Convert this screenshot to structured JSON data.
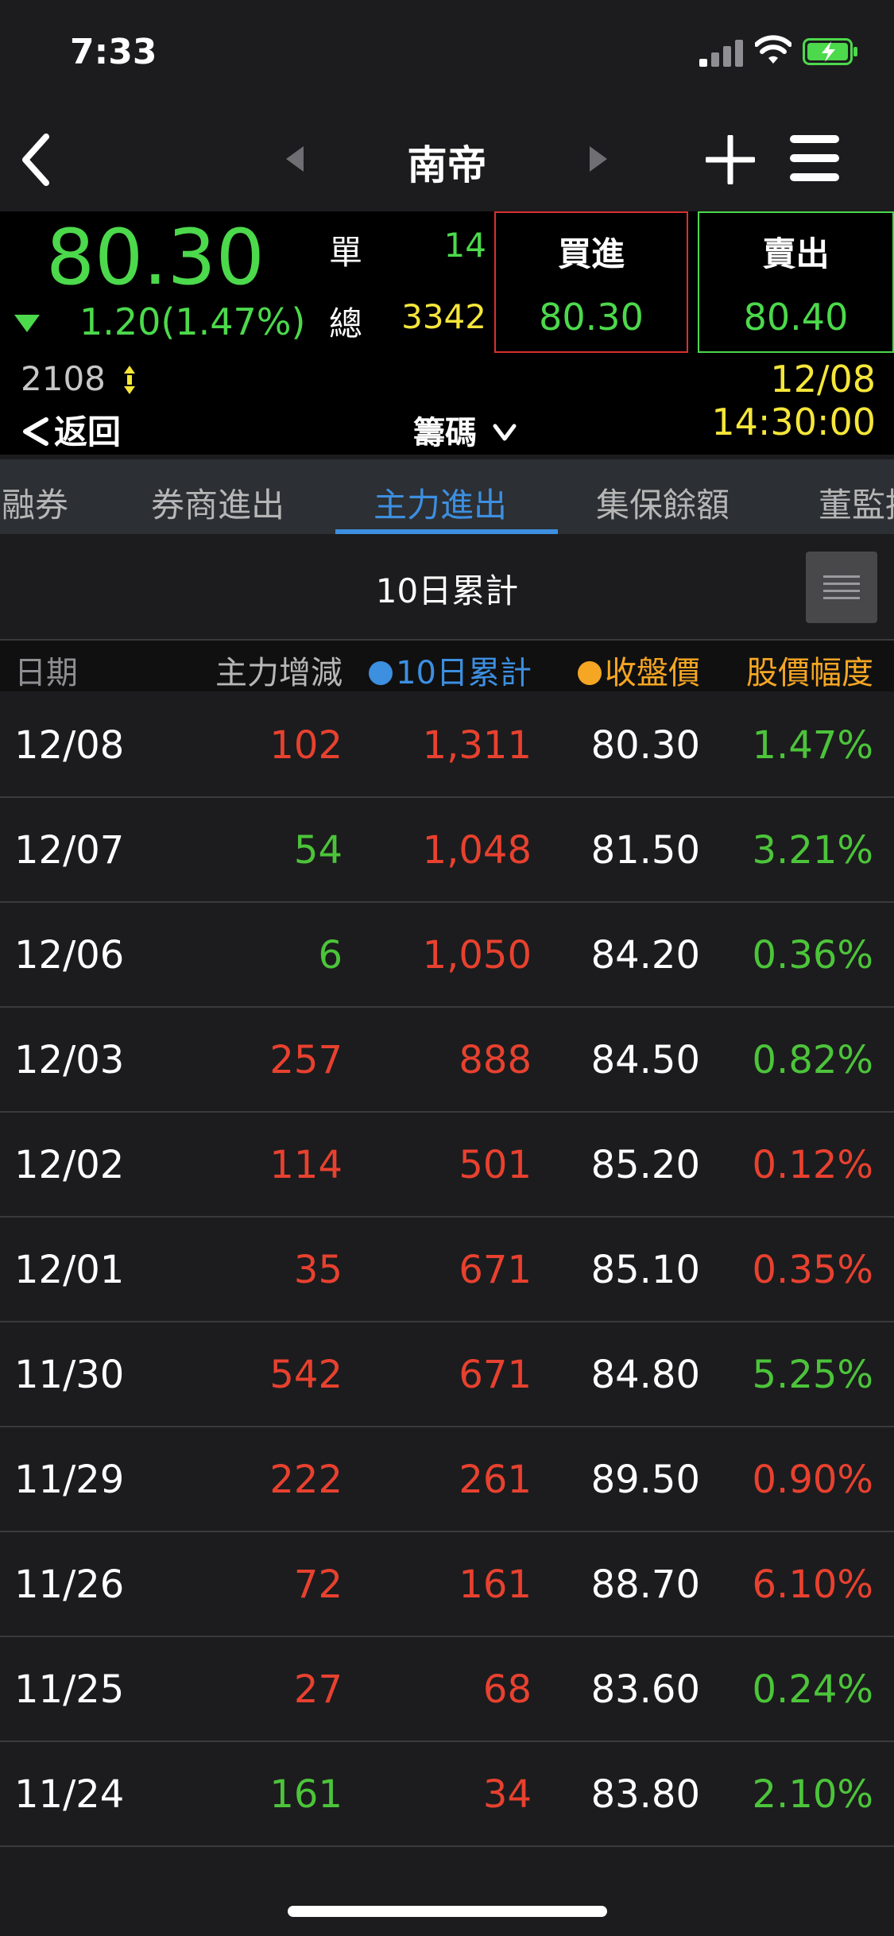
{
  "status_bar": {
    "time": "7:33"
  },
  "nav": {
    "title": "南帝"
  },
  "quote": {
    "price": "80.30",
    "change": "1.20(1.47%)",
    "unit_label": "單",
    "unit_value": "14",
    "total_label": "總",
    "total_value": "3342",
    "buy_label": "買進",
    "buy_price": "80.30",
    "sell_label": "賣出",
    "sell_price": "80.40",
    "volume": "2108",
    "datetime": "12/08 14:30:00",
    "back_label": "返回",
    "chips_label": "籌碼"
  },
  "tabs": [
    {
      "label": "融券"
    },
    {
      "label": "券商進出"
    },
    {
      "label": "主力進出"
    },
    {
      "label": "集保餘額"
    },
    {
      "label": "董監持股"
    }
  ],
  "section": {
    "title": "10日累計"
  },
  "columns": {
    "date": "日期",
    "main": "主力增減",
    "acc": "10日累計",
    "close": "收盤價",
    "pct": "股價幅度"
  },
  "colors": {
    "up": "#e8412f",
    "down": "#4cc43a",
    "accent": "#3d8fe0",
    "orange": "#f5a623"
  },
  "rows": [
    {
      "date": "12/08",
      "main": "102",
      "main_color": "red",
      "acc": "1,311",
      "acc_color": "red",
      "close": "80.30",
      "pct": "1.47%",
      "pct_color": "green"
    },
    {
      "date": "12/07",
      "main": "54",
      "main_color": "green",
      "acc": "1,048",
      "acc_color": "red",
      "close": "81.50",
      "pct": "3.21%",
      "pct_color": "green"
    },
    {
      "date": "12/06",
      "main": "6",
      "main_color": "green",
      "acc": "1,050",
      "acc_color": "red",
      "close": "84.20",
      "pct": "0.36%",
      "pct_color": "green"
    },
    {
      "date": "12/03",
      "main": "257",
      "main_color": "red",
      "acc": "888",
      "acc_color": "red",
      "close": "84.50",
      "pct": "0.82%",
      "pct_color": "green"
    },
    {
      "date": "12/02",
      "main": "114",
      "main_color": "red",
      "acc": "501",
      "acc_color": "red",
      "close": "85.20",
      "pct": "0.12%",
      "pct_color": "red"
    },
    {
      "date": "12/01",
      "main": "35",
      "main_color": "red",
      "acc": "671",
      "acc_color": "red",
      "close": "85.10",
      "pct": "0.35%",
      "pct_color": "red"
    },
    {
      "date": "11/30",
      "main": "542",
      "main_color": "red",
      "acc": "671",
      "acc_color": "red",
      "close": "84.80",
      "pct": "5.25%",
      "pct_color": "green"
    },
    {
      "date": "11/29",
      "main": "222",
      "main_color": "red",
      "acc": "261",
      "acc_color": "red",
      "close": "89.50",
      "pct": "0.90%",
      "pct_color": "red"
    },
    {
      "date": "11/26",
      "main": "72",
      "main_color": "red",
      "acc": "161",
      "acc_color": "red",
      "close": "88.70",
      "pct": "6.10%",
      "pct_color": "red"
    },
    {
      "date": "11/25",
      "main": "27",
      "main_color": "red",
      "acc": "68",
      "acc_color": "red",
      "close": "83.60",
      "pct": "0.24%",
      "pct_color": "green"
    },
    {
      "date": "11/24",
      "main": "161",
      "main_color": "green",
      "acc": "34",
      "acc_color": "red",
      "close": "83.80",
      "pct": "2.10%",
      "pct_color": "green"
    }
  ]
}
